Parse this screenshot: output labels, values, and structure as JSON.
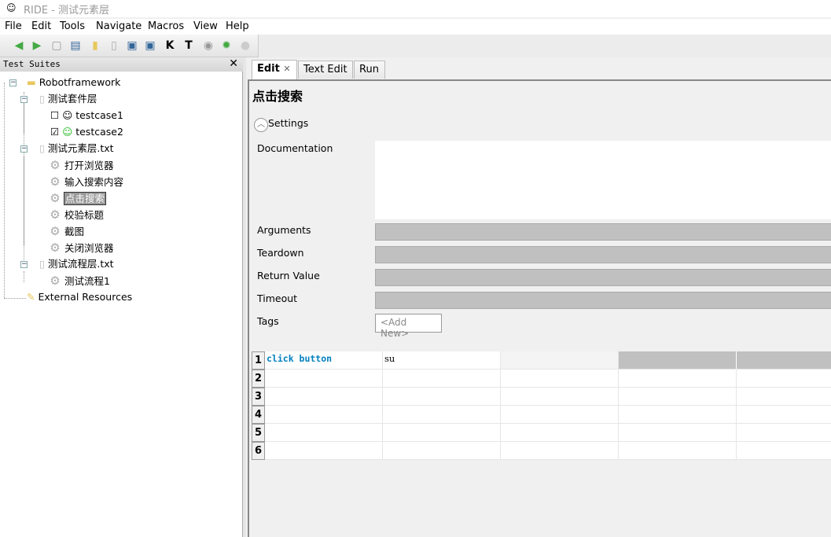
{
  "window": {
    "title": "RIDE - 测试元素层"
  },
  "menu": [
    "File",
    "Edit",
    "Tools",
    "Navigate",
    "Macros",
    "View",
    "Help"
  ],
  "toolbar": [
    "back-icon",
    "forward-icon",
    "new-project-icon",
    "open-icon",
    "open-dir-icon",
    "new-resource-icon",
    "save-icon",
    "save-all-icon",
    "search-keywords-icon",
    "search-tests-icon",
    "run-icon",
    "debug-icon",
    "stop-icon"
  ],
  "tree": {
    "header": "Test Suites",
    "root": "Robotframework",
    "suite1": {
      "name": "测试套件层",
      "tests": [
        {
          "name": "testcase1",
          "checked": false
        },
        {
          "name": "testcase2",
          "checked": true
        }
      ]
    },
    "resource1": {
      "name": "测试元素层.txt",
      "keywords": [
        "打开浏览器",
        "输入搜索内容",
        "点击搜索",
        "校验标题",
        "截图",
        "关闭浏览器"
      ]
    },
    "resource2": {
      "name": "测试流程层.txt",
      "keywords": [
        "测试流程1"
      ]
    },
    "external": "External Resources",
    "selected": "点击搜索"
  },
  "tabs": [
    "Edit",
    "Text Edit",
    "Run"
  ],
  "editor": {
    "title": "点击搜索",
    "settings_label": "Settings",
    "fields": {
      "documentation": "Documentation",
      "arguments": "Arguments",
      "teardown": "Teardown",
      "return_value": "Return Value",
      "timeout": "Timeout",
      "tags": "Tags"
    },
    "add_new": "<Add New>",
    "rows": [
      "1",
      "2",
      "3",
      "4",
      "5",
      "6"
    ],
    "steps": [
      {
        "keyword": "click button",
        "arg": "su"
      }
    ],
    "keyword_color": "#0080c0"
  }
}
